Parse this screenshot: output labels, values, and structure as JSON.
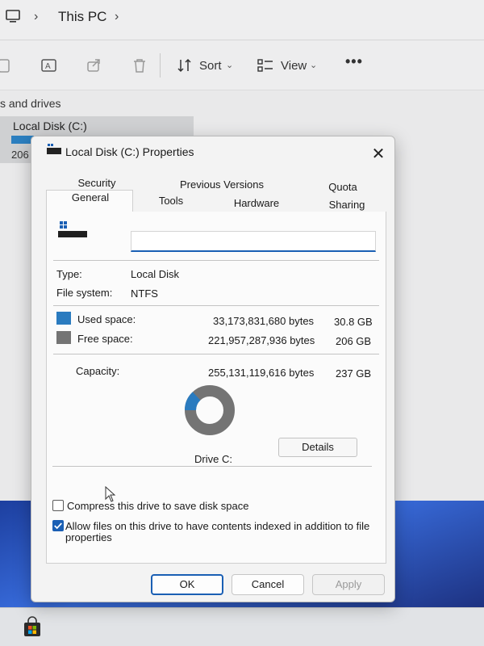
{
  "explorer": {
    "breadcrumb": "This PC",
    "toolbar": {
      "sort_label": "Sort",
      "view_label": "View",
      "more_label": "•••"
    },
    "section_header": "s and drives",
    "drive_tile": {
      "label": "Local Disk (C:)",
      "size_text": "206 G"
    }
  },
  "dialog": {
    "title": "Local Disk (C:) Properties",
    "close_symbol": "✕",
    "tabs_row1": [
      "Security",
      "Previous Versions",
      "Quota"
    ],
    "tabs_row2": [
      "General",
      "Tools",
      "Hardware",
      "Sharing"
    ],
    "active_tab": "General",
    "name_field_value": "",
    "type_label": "Type:",
    "type_value": "Local Disk",
    "fs_label": "File system:",
    "fs_value": "NTFS",
    "used": {
      "label": "Used space:",
      "bytes": "33,173,831,680 bytes",
      "size": "30.8 GB",
      "color": "#2a7bbf"
    },
    "free": {
      "label": "Free space:",
      "bytes": "221,957,287,936 bytes",
      "size": "206 GB",
      "color": "#747474"
    },
    "capacity": {
      "label": "Capacity:",
      "bytes": "255,131,119,616 bytes",
      "size": "237 GB"
    },
    "used_fraction": 0.13,
    "drive_caption": "Drive C:",
    "details_label": "Details",
    "compress_label": "Compress this drive to save disk space",
    "compress_checked": false,
    "index_label_line1": "Allow files on this drive to have contents indexed in addition to file",
    "index_label_line2": "properties",
    "index_checked": true,
    "ok_label": "OK",
    "cancel_label": "Cancel",
    "apply_label": "Apply"
  }
}
